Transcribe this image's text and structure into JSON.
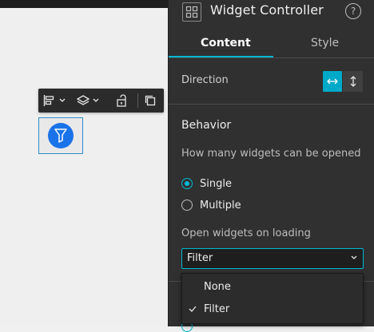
{
  "panel": {
    "title": "Widget Controller",
    "help_glyph": "?",
    "tabs": [
      {
        "label": "Content",
        "active": true
      },
      {
        "label": "Style",
        "active": false
      }
    ],
    "direction": {
      "label": "Direction",
      "options": [
        {
          "icon": "horizontal-arrows-icon",
          "selected": true
        },
        {
          "icon": "vertical-arrows-icon",
          "selected": false
        }
      ]
    },
    "behavior": {
      "title": "Behavior",
      "how_many_label": "How many widgets can be opened",
      "options": [
        {
          "label": "Single",
          "checked": true
        },
        {
          "label": "Multiple",
          "checked": false
        }
      ],
      "open_on_loading_label": "Open widgets on loading",
      "select_value": "Filter",
      "dropdown_options": [
        {
          "label": "None",
          "selected": false
        },
        {
          "label": "Filter",
          "selected": true
        }
      ]
    }
  },
  "toolbar": {
    "icons": [
      "align-icon",
      "chevron-down-icon",
      "layers-icon",
      "chevron-down-icon",
      "unlock-icon",
      "duplicate-icon"
    ]
  },
  "canvas_widget": {
    "icon": "filter-icon",
    "color": "#1a73e8"
  },
  "colors": {
    "accent": "#00b8d4",
    "panel_bg": "#303030",
    "canvas_bg": "#efefef"
  }
}
